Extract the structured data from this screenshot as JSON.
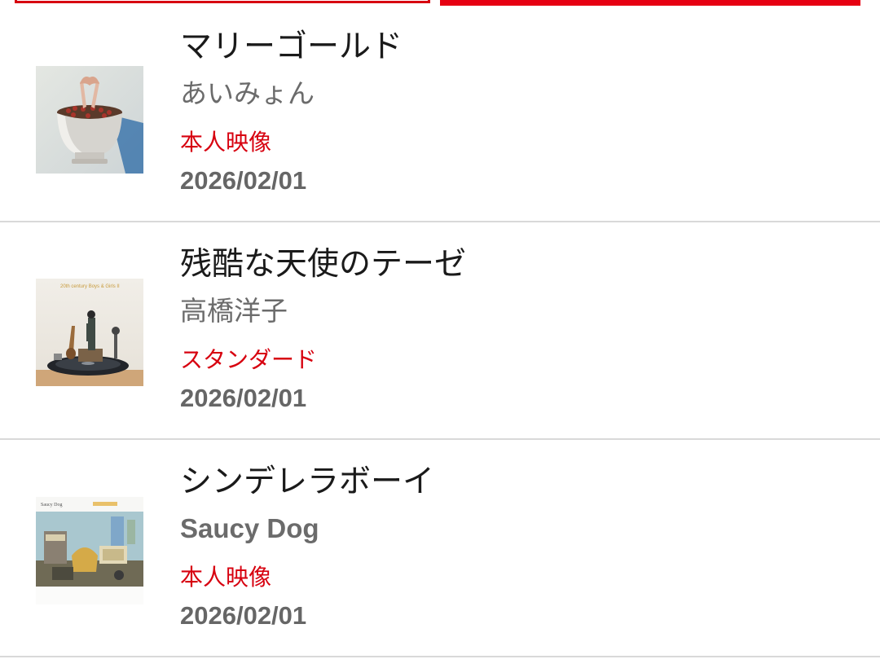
{
  "colors": {
    "accent": "#e60012",
    "type_label": "#d7000f",
    "title": "#1a1a1a",
    "artist": "#6b6b6b",
    "date": "#666666",
    "divider": "#d9d9d9"
  },
  "songs": [
    {
      "title": "マリーゴールド",
      "artist": "あいみょん",
      "video_type": "本人映像",
      "date": "2026/02/01",
      "thumbnail": "album-art-bowl-hands"
    },
    {
      "title": "残酷な天使のテーゼ",
      "artist": "高橋洋子",
      "video_type": "スタンダード",
      "date": "2026/02/01",
      "thumbnail": "album-art-figure-record",
      "thumbnail_text": "20th century Boys & Girls II"
    },
    {
      "title": "シンデレラボーイ",
      "artist": "Saucy Dog",
      "video_type": "本人映像",
      "date": "2026/02/01",
      "thumbnail": "album-art-room-scene",
      "thumbnail_text": "Saucy Dog"
    }
  ]
}
